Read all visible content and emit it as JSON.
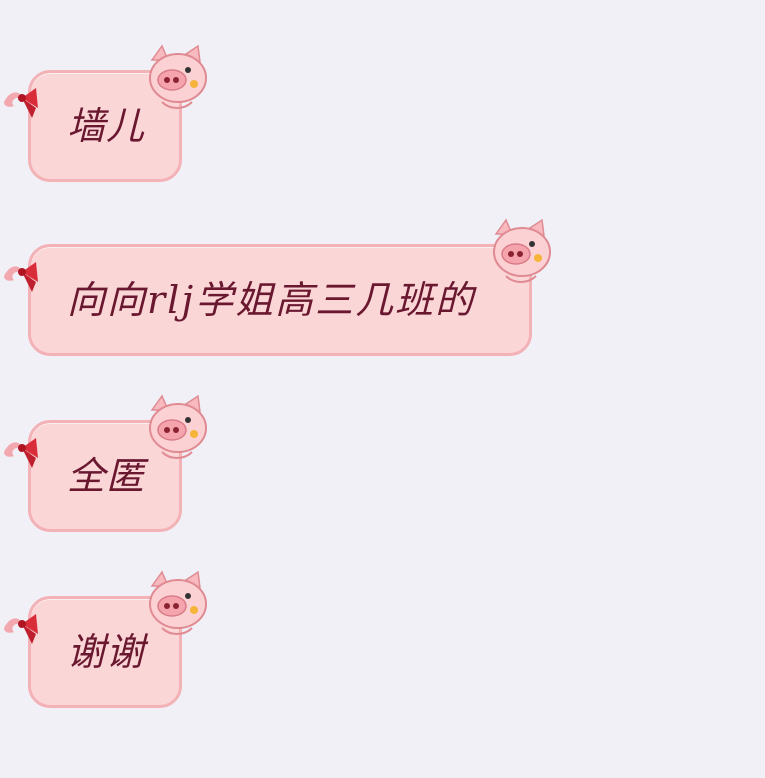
{
  "messages": [
    {
      "text": "墙儿"
    },
    {
      "text": "向向rlj学姐高三几班的"
    },
    {
      "text": "全匿"
    },
    {
      "text": "谢谢"
    }
  ],
  "theme": {
    "background": "#f1f0f6",
    "bubble_fill": "#fbd6d7",
    "bubble_border": "#f2b2b6",
    "text_color": "#6a1830",
    "bow_color": "#d92d3a",
    "pig_pink": "#f8b9bf"
  },
  "icons": {
    "bow": "ribbon-bow-icon",
    "pig": "pig-mascot-icon"
  }
}
